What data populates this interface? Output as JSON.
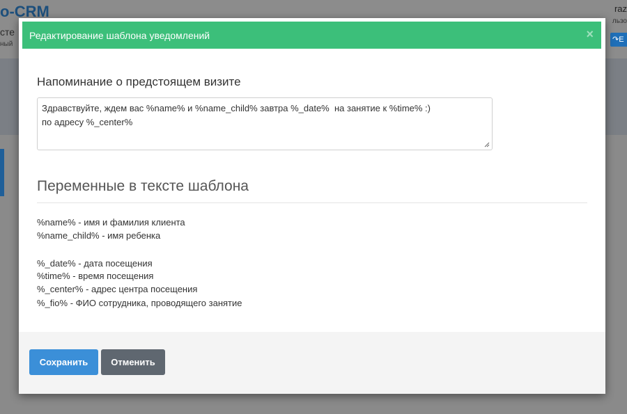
{
  "background": {
    "logo": "o-CRM",
    "subtitle_1": "сте",
    "subtitle_2": "ный",
    "user": "raz",
    "role": "льзо",
    "exit_icon": "sign-in-icon",
    "exit_label": "E"
  },
  "modal": {
    "title": "Редактирование шаблона уведомлений",
    "close_label": "×",
    "template_label": "Напоминание о предстоящем визите",
    "template_text": "Здравствуйте, ждем вас %name% и %name_child% завтра %_date%  на занятие к %time% :)\nпо адресу %_center%",
    "variables_title": "Переменные в тексте шаблона",
    "variables": [
      "%name% - имя и фамилия клиента",
      "%name_child% - имя ребенка",
      "%_date% - дата посещения",
      "%time% - время посещения",
      "%_center% - адрес центра посещения",
      "%_fio% - ФИО сотрудника, проводящего занятие"
    ],
    "save_label": "Сохранить",
    "cancel_label": "Отменить"
  },
  "colors": {
    "header": "#3cbf7a",
    "save_button": "#3b8fd8",
    "cancel_button": "#5f6770"
  }
}
